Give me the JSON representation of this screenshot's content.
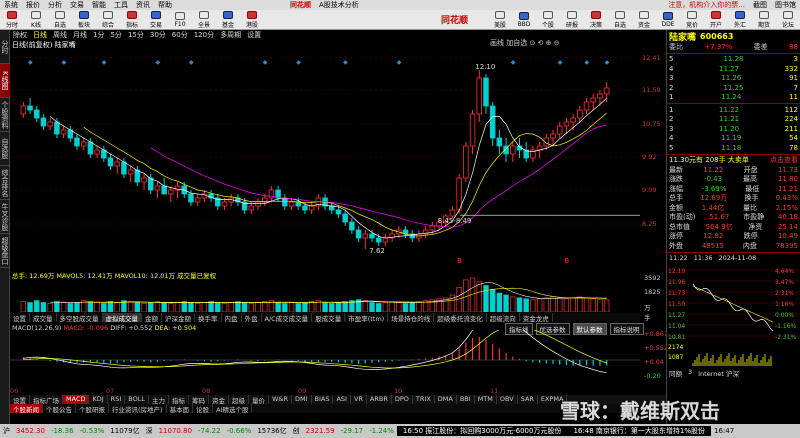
{
  "menu": {
    "items": [
      "系统",
      "报价",
      "分析",
      "交易",
      "智能",
      "工具",
      "资讯",
      "帮助"
    ],
    "brand": "同花顺",
    "app_title": "A股技术分析",
    "right_note": "注意，机构介入你的票...",
    "right_links": [
      "截图",
      "图书馆"
    ]
  },
  "toolbar": {
    "buttons": [
      "分时",
      "K线",
      "自选",
      "板块",
      "综合",
      "指标",
      "交易",
      "F10",
      "全景",
      "基金",
      "港股",
      "美股",
      "BBD",
      "个股",
      "研报",
      "决策",
      "自选",
      "资金",
      "DDE",
      "竞价",
      "开户",
      "外汇",
      "期货",
      "论坛"
    ]
  },
  "left_tabs": [
    "分时",
    "K线图",
    "个股资料",
    "自选股",
    "综合排名",
    "牛叉诊股",
    "超级盘口"
  ],
  "period": {
    "items": [
      "除权",
      "日线",
      "周线",
      "月线",
      "1分",
      "5分",
      "15分",
      "30分",
      "60分",
      "120分",
      "多周期",
      "设置"
    ],
    "selected": "日线"
  },
  "subtitle": "日线(前复权) 陆家嘴",
  "rt_tools": "画线 加自选 ⊙ ⟲ ⊕ ⊖",
  "price_axis": [
    "12.41",
    "11.59",
    "10.75",
    "9.92",
    "9.09",
    "8.25"
  ],
  "annotations": {
    "high": "12.10",
    "low": "7.62",
    "range": "8.45-8.49",
    "marker1": "B",
    "marker2": "B"
  },
  "volume": {
    "label": "总手: 12.69万 MAVOL5: 12.41万 MAVOL10: 12.01万 成交量已复权",
    "axis": [
      "3592",
      "1825",
      "万手"
    ]
  },
  "indicator_tabs": [
    "设置",
    "成交量",
    "多空股成交量",
    "虚拟成交量",
    "金额",
    "沪深金额",
    "换手率",
    "内盘",
    "外盘",
    "A/C成交成交量",
    "股成交量",
    "市盈率(ttm)",
    "场景持仓的线",
    "超级委托流变化",
    "超级流向",
    "资金龙虎"
  ],
  "macd": {
    "label": "MACD(12,26,9)",
    "value": "MACD: -0.096",
    "diff": "DIFF: +0.552",
    "dea": "DEA: +0.504",
    "axis": [
      "+0.867",
      "+0.552",
      "+0.04",
      "-0.20"
    ],
    "buttons": [
      "指标线",
      "优选参数",
      "默认参数",
      "指标说明"
    ]
  },
  "x_dates": [
    "06",
    "07",
    "08",
    "09",
    "10",
    "11"
  ],
  "bottom_tabs": [
    "设置",
    "指标广场",
    "MACD",
    "KDJ",
    "RSI",
    "BOLL",
    "主力",
    "指标",
    "筹码",
    "资金",
    "超级",
    "量价",
    "W&R",
    "DMI",
    "BIAS",
    "ASI",
    "VR",
    "ARBR",
    "DPO",
    "TRIX",
    "DMA",
    "BBI",
    "MTM",
    "OBV",
    "SAR",
    "EXPMA"
  ],
  "bottom_selected": "MACD",
  "news_tabs": [
    "个股新闻",
    "个股公告",
    "个股研报",
    "行业资讯(房地产)",
    "基本面",
    "论股",
    "AI精选个股"
  ],
  "quote": {
    "name": "陆家嘴",
    "code": "600663",
    "ratio_label": "委比",
    "ratio": "+7.37%",
    "diff_label": "委差",
    "diff": "88",
    "sell": [
      [
        "5",
        "11.28",
        "3"
      ],
      [
        "4",
        "11.27",
        "332"
      ],
      [
        "3",
        "11.26",
        "91"
      ],
      [
        "2",
        "11.25",
        "7"
      ],
      [
        "1",
        "11.24",
        "11"
      ]
    ],
    "buy": [
      [
        "1",
        "11.22",
        "112"
      ],
      [
        "2",
        "11.21",
        "224"
      ],
      [
        "3",
        "11.20",
        "211"
      ],
      [
        "4",
        "11.19",
        "54"
      ],
      [
        "5",
        "11.18",
        "78"
      ]
    ],
    "summary_line": "11.30元有 208手 大卖单",
    "summary_link": "点击查看",
    "fields_left": [
      [
        "最新",
        "11.22"
      ],
      [
        "涨跌",
        "-0.43"
      ],
      [
        "涨幅",
        "-3.69%"
      ],
      [
        "总手",
        "12.69万"
      ],
      [
        "金额",
        "1.44亿"
      ],
      [
        "市盈(动)",
        "51.67"
      ],
      [
        "总市值",
        "564.9亿"
      ],
      [
        "涨停",
        "12.82"
      ],
      [
        "外盘",
        "48515"
      ]
    ],
    "fields_right": [
      [
        "开盘",
        "11.73"
      ],
      [
        "最高",
        "11.80"
      ],
      [
        "最低",
        "11.21"
      ],
      [
        "换手",
        "0.43%"
      ],
      [
        "量比",
        "2.15%"
      ],
      [
        "市盈静",
        "40.18"
      ],
      [
        "净资",
        "25.14"
      ],
      [
        "跌停",
        "10.49"
      ],
      [
        "内盘",
        "78395"
      ]
    ],
    "mini_axis_left": [
      "12.19",
      "11.96",
      "11.73",
      "11.50",
      "11.27",
      "11.04",
      "10.81"
    ],
    "mini_axis_right": [
      "4.64%",
      "3.47%",
      "2.31%",
      "1.16%",
      "0.00%",
      "-1.16%",
      "-2.31%"
    ],
    "mini_time": [
      "11:22",
      "11:36",
      "2024-11-08"
    ],
    "mini_vol": [
      "2174",
      "1087"
    ],
    "foot": [
      "同额",
      "3",
      "Internet 沪深"
    ]
  },
  "status": {
    "items": [
      {
        "t": "沪",
        "c": ""
      },
      {
        "t": "3452.30",
        "c": "r"
      },
      {
        "t": "-18.36",
        "c": "g"
      },
      {
        "t": "-0.53%",
        "c": "g"
      },
      {
        "t": "11079亿",
        "c": ""
      },
      {
        "t": "深",
        "c": ""
      },
      {
        "t": "11070.80",
        "c": "r"
      },
      {
        "t": "-74.22",
        "c": "g"
      },
      {
        "t": "-0.66%",
        "c": "g"
      },
      {
        "t": "15736亿",
        "c": ""
      },
      {
        "t": "创",
        "c": ""
      },
      {
        "t": "2321.59",
        "c": "r"
      },
      {
        "t": "-29.17",
        "c": "g"
      },
      {
        "t": "-1.24%",
        "c": "g"
      }
    ],
    "news1": "16:50 振江股份：拟回购3000万元-6000万元股份",
    "news2": "16:48 南京银行：第一大股东增持1%股份",
    "time": "16:47"
  },
  "watermark": "雪球：戴维斯双击",
  "chart_data": {
    "type": "candlestick",
    "x_labels": [
      "06",
      "07",
      "08",
      "09",
      "10",
      "11"
    ],
    "y_range": [
      7.4,
      12.5
    ],
    "series": [
      {
        "ohlc": [
          [
            11.0,
            11.3,
            10.9,
            11.2
          ],
          [
            11.2,
            11.4,
            11.0,
            11.1
          ],
          [
            11.1,
            11.2,
            10.8,
            10.9
          ],
          [
            10.9,
            11.0,
            10.6,
            10.7
          ],
          [
            10.7,
            10.9,
            10.6,
            10.8
          ],
          [
            10.8,
            10.9,
            10.4,
            10.5
          ],
          [
            10.5,
            10.7,
            10.4,
            10.6
          ],
          [
            10.6,
            10.7,
            10.3,
            10.4
          ],
          [
            10.4,
            10.5,
            10.1,
            10.2
          ],
          [
            10.2,
            10.4,
            10.1,
            10.3
          ],
          [
            10.3,
            10.4,
            9.9,
            10.0
          ],
          [
            10.0,
            10.2,
            9.9,
            10.1
          ],
          [
            10.1,
            10.2,
            9.8,
            9.9
          ],
          [
            9.9,
            10.0,
            9.6,
            9.7
          ],
          [
            9.7,
            9.9,
            9.5,
            9.8
          ],
          [
            9.8,
            9.9,
            9.4,
            9.5
          ],
          [
            9.5,
            9.7,
            9.3,
            9.6
          ],
          [
            9.6,
            9.7,
            9.2,
            9.3
          ],
          [
            9.3,
            9.5,
            9.1,
            9.4
          ],
          [
            9.4,
            9.5,
            9.0,
            9.1
          ],
          [
            9.1,
            9.3,
            8.9,
            9.2
          ],
          [
            9.2,
            9.4,
            9.0,
            9.0
          ],
          [
            9.0,
            9.2,
            8.8,
            9.1
          ],
          [
            9.1,
            9.3,
            8.9,
            9.2
          ],
          [
            9.2,
            9.3,
            8.9,
            9.0
          ],
          [
            9.0,
            9.1,
            8.7,
            8.8
          ],
          [
            8.8,
            9.0,
            8.7,
            8.9
          ],
          [
            8.9,
            9.1,
            8.8,
            9.0
          ],
          [
            9.0,
            9.1,
            8.8,
            8.9
          ],
          [
            8.9,
            9.0,
            8.6,
            8.7
          ],
          [
            8.7,
            8.9,
            8.6,
            8.8
          ],
          [
            8.8,
            9.0,
            8.7,
            8.9
          ],
          [
            8.9,
            9.0,
            8.7,
            8.8
          ],
          [
            8.8,
            8.9,
            8.5,
            8.6
          ],
          [
            8.6,
            8.8,
            8.5,
            8.7
          ],
          [
            8.7,
            8.9,
            8.6,
            8.8
          ],
          [
            8.8,
            9.0,
            8.7,
            8.9
          ],
          [
            8.9,
            9.2,
            8.8,
            9.1
          ],
          [
            9.1,
            9.2,
            8.8,
            8.9
          ],
          [
            8.9,
            9.0,
            8.6,
            8.7
          ],
          [
            8.7,
            8.9,
            8.6,
            8.8
          ],
          [
            8.8,
            8.9,
            8.6,
            8.7
          ],
          [
            8.7,
            8.8,
            8.5,
            8.6
          ],
          [
            8.6,
            8.8,
            8.5,
            8.7
          ],
          [
            8.7,
            9.0,
            8.6,
            8.9
          ],
          [
            8.9,
            9.0,
            8.6,
            8.7
          ],
          [
            8.7,
            8.8,
            8.5,
            8.6
          ],
          [
            8.6,
            8.7,
            8.4,
            8.5
          ],
          [
            8.5,
            8.6,
            8.2,
            8.3
          ],
          [
            8.3,
            8.4,
            8.0,
            8.1
          ],
          [
            8.1,
            8.2,
            7.8,
            7.9
          ],
          [
            7.9,
            8.1,
            7.62,
            8.0
          ],
          [
            8.0,
            8.1,
            7.8,
            7.9
          ],
          [
            7.9,
            8.0,
            7.7,
            7.8
          ],
          [
            7.8,
            8.0,
            7.7,
            7.9
          ],
          [
            7.9,
            8.1,
            7.8,
            8.0
          ],
          [
            8.0,
            8.2,
            7.9,
            8.1
          ],
          [
            8.1,
            8.2,
            7.9,
            8.0
          ],
          [
            8.0,
            8.1,
            7.8,
            7.9
          ],
          [
            7.9,
            8.1,
            7.8,
            8.0
          ],
          [
            8.0,
            8.2,
            7.9,
            8.1
          ],
          [
            8.1,
            8.3,
            8.0,
            8.2
          ],
          [
            8.2,
            8.4,
            8.1,
            8.3
          ],
          [
            8.3,
            8.5,
            8.2,
            8.45
          ],
          [
            8.45,
            8.7,
            8.4,
            8.6
          ],
          [
            8.6,
            9.5,
            8.5,
            9.4
          ],
          [
            9.4,
            10.3,
            9.3,
            10.2
          ],
          [
            10.2,
            11.1,
            10.0,
            11.0
          ],
          [
            11.0,
            12.1,
            10.8,
            11.9
          ],
          [
            11.9,
            12.0,
            11.0,
            11.2
          ],
          [
            11.2,
            11.3,
            10.2,
            10.4
          ],
          [
            10.4,
            10.6,
            10.0,
            10.2
          ],
          [
            10.2,
            10.4,
            9.8,
            10.0
          ],
          [
            10.0,
            10.3,
            9.8,
            10.2
          ],
          [
            10.2,
            10.4,
            9.9,
            10.1
          ],
          [
            10.1,
            10.3,
            9.8,
            9.9
          ],
          [
            9.9,
            10.2,
            9.8,
            10.1
          ],
          [
            10.1,
            10.3,
            9.9,
            10.2
          ],
          [
            10.2,
            10.5,
            10.1,
            10.4
          ],
          [
            10.4,
            10.6,
            10.2,
            10.5
          ],
          [
            10.5,
            10.8,
            10.4,
            10.7
          ],
          [
            10.7,
            10.9,
            10.5,
            10.8
          ],
          [
            10.8,
            11.0,
            10.6,
            10.9
          ],
          [
            10.9,
            11.2,
            10.8,
            11.1
          ],
          [
            11.1,
            11.4,
            11.0,
            11.3
          ],
          [
            11.3,
            11.5,
            11.1,
            11.4
          ],
          [
            11.4,
            11.6,
            11.2,
            11.5
          ],
          [
            11.5,
            11.8,
            11.3,
            11.65
          ]
        ],
        "volume": [
          1.1,
          1.0,
          1.2,
          1.0,
          0.9,
          1.1,
          1.0,
          0.9,
          1.0,
          1.2,
          1.1,
          1.0,
          0.9,
          1.1,
          1.0,
          1.2,
          1.1,
          1.0,
          0.9,
          1.0,
          1.1,
          1.0,
          0.9,
          1.0,
          1.1,
          1.0,
          0.9,
          1.0,
          1.1,
          1.0,
          0.9,
          1.0,
          1.1,
          1.0,
          0.9,
          1.0,
          1.1,
          1.2,
          1.0,
          0.9,
          1.0,
          0.9,
          1.0,
          1.1,
          1.2,
          1.0,
          0.9,
          1.0,
          1.1,
          1.2,
          1.3,
          1.2,
          1.0,
          0.9,
          1.0,
          1.1,
          1.0,
          0.9,
          1.0,
          1.1,
          1.2,
          1.3,
          1.4,
          1.5,
          1.8,
          2.6,
          3.4,
          3.6,
          3.2,
          2.8,
          2.4,
          2.0,
          1.8,
          1.6,
          1.5,
          1.4,
          1.3,
          1.4,
          1.5,
          1.6,
          1.5,
          1.4,
          1.5,
          1.6,
          1.5,
          1.4,
          1.3,
          1.27
        ],
        "macd_hist": [
          0.05,
          0.04,
          0.02,
          0.0,
          -0.02,
          -0.03,
          -0.04,
          -0.05,
          -0.05,
          -0.04,
          -0.03,
          -0.04,
          -0.05,
          -0.06,
          -0.05,
          -0.04,
          -0.03,
          -0.02,
          -0.03,
          -0.04,
          -0.03,
          -0.02,
          -0.01,
          0.0,
          0.01,
          0.0,
          -0.01,
          -0.02,
          -0.03,
          -0.02,
          -0.01,
          0.0,
          0.01,
          0.0,
          -0.01,
          -0.02,
          -0.01,
          0.0,
          0.01,
          0.0,
          -0.01,
          -0.02,
          -0.03,
          -0.04,
          -0.05,
          -0.04,
          -0.03,
          -0.04,
          -0.05,
          -0.06,
          -0.07,
          -0.06,
          -0.05,
          -0.04,
          -0.03,
          -0.02,
          -0.01,
          0.0,
          0.01,
          0.02,
          0.03,
          0.04,
          0.06,
          0.08,
          0.12,
          0.2,
          0.3,
          0.38,
          0.4,
          0.35,
          0.28,
          0.2,
          0.12,
          0.06,
          0.02,
          -0.02,
          -0.04,
          -0.05,
          -0.06,
          -0.07,
          -0.08,
          -0.09,
          -0.1,
          -0.1,
          -0.09,
          -0.1,
          -0.1,
          -0.096
        ]
      }
    ]
  }
}
